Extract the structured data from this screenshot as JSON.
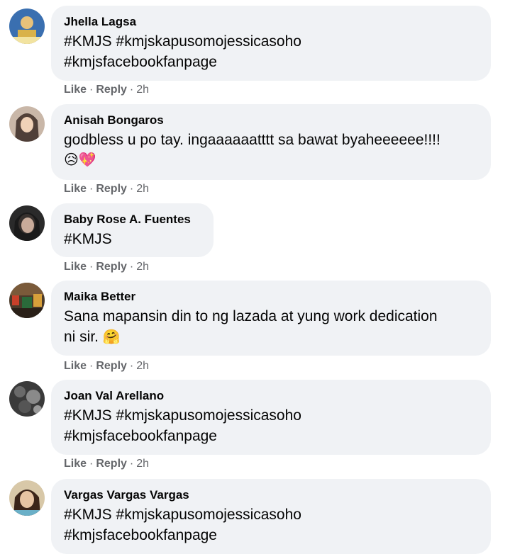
{
  "labels": {
    "like": "Like",
    "reply": "Reply"
  },
  "comments": [
    {
      "author": "Jhella Lagsa",
      "lines": [
        "#KMJS #kmjskapusomojessicasoho",
        "#kmjsfacebookfanpage"
      ],
      "emoji": "",
      "time": "2h"
    },
    {
      "author": "Anisah Bongaros",
      "lines": [
        "godbless u po tay. ingaaaaaatttt sa bawat byaheeeeee!!!!"
      ],
      "emoji": "😥💖",
      "time": "2h"
    },
    {
      "author": "Baby Rose A. Fuentes",
      "lines": [
        "#KMJS"
      ],
      "emoji": "",
      "time": "2h"
    },
    {
      "author": "Maika Better",
      "lines": [
        "Sana mapansin din to ng lazada at yung work dedication",
        "ni sir."
      ],
      "emoji": "🤗",
      "time": "2h"
    },
    {
      "author": "Joan Val Arellano",
      "lines": [
        "#KMJS #kmjskapusomojessicasoho",
        "#kmjsfacebookfanpage"
      ],
      "emoji": "",
      "time": "2h"
    },
    {
      "author": "Vargas Vargas Vargas",
      "lines": [
        "#KMJS #kmjskapusomojessicasoho",
        "#kmjsfacebookfanpage"
      ],
      "emoji": "",
      "time": ""
    }
  ]
}
